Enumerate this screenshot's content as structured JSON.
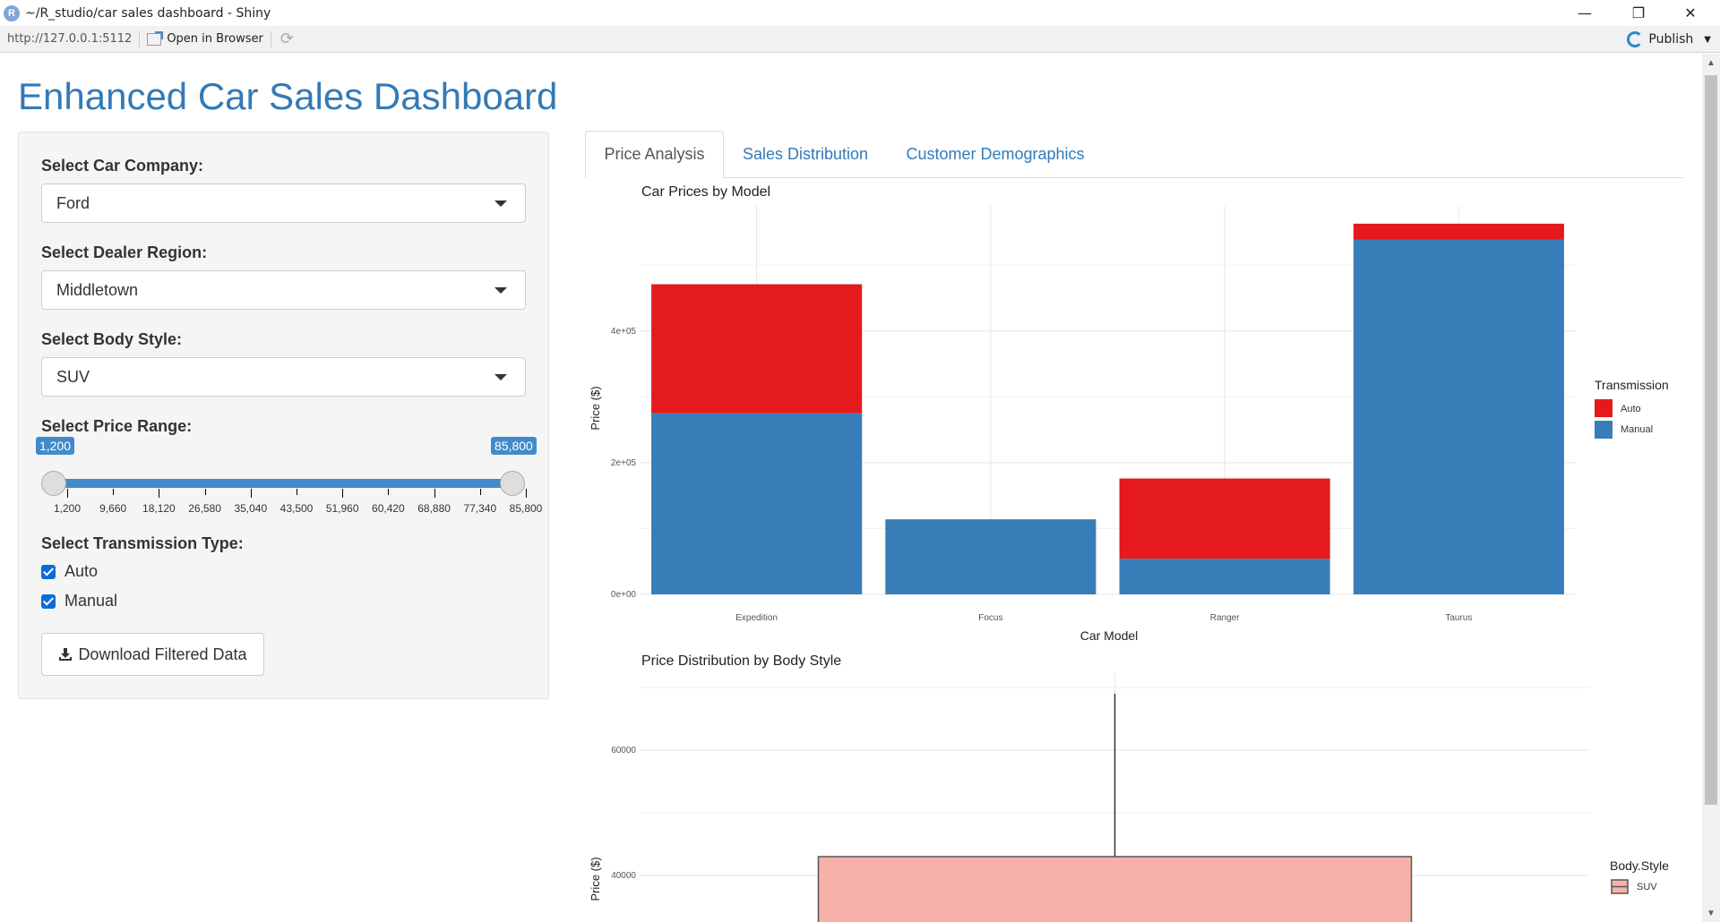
{
  "window": {
    "title": "~/R_studio/car sales dashboard - Shiny",
    "minimize": "—",
    "restore": "❐",
    "close": "✕"
  },
  "toolbar": {
    "url": "http://127.0.0.1:5112",
    "open_in_browser": "Open in Browser",
    "publish": "Publish"
  },
  "app": {
    "title": "Enhanced Car Sales Dashboard"
  },
  "sidebar": {
    "company_label": "Select Car Company:",
    "company_value": "Ford",
    "region_label": "Select Dealer Region:",
    "region_value": "Middletown",
    "body_label": "Select Body Style:",
    "body_value": "SUV",
    "price_label": "Select Price Range:",
    "price_min": "1,200",
    "price_max": "85,800",
    "price_ticks": [
      "1,200",
      "9,660",
      "18,120",
      "26,580",
      "35,040",
      "43,500",
      "51,960",
      "60,420",
      "68,880",
      "77,340",
      "85,800"
    ],
    "transmission_label": "Select Transmission Type:",
    "transmission_options": [
      {
        "label": "Auto",
        "checked": true
      },
      {
        "label": "Manual",
        "checked": true
      }
    ],
    "download_label": "Download Filtered Data"
  },
  "tabs": [
    {
      "label": "Price Analysis",
      "active": true
    },
    {
      "label": "Sales Distribution",
      "active": false
    },
    {
      "label": "Customer Demographics",
      "active": false
    }
  ],
  "colors": {
    "auto": "#e41a1c",
    "manual": "#377eb8",
    "suv": "#f8b1aa",
    "accent": "#337ab7"
  },
  "chart_data": [
    {
      "type": "bar",
      "stacked": true,
      "title": "Car Prices by Model",
      "xlabel": "Car Model",
      "ylabel": "Price ($)",
      "categories": [
        "Expedition",
        "Focus",
        "Ranger",
        "Taurus"
      ],
      "series": [
        {
          "name": "Auto",
          "values": [
            196000,
            0,
            122000,
            24000
          ]
        },
        {
          "name": "Manual",
          "values": [
            275000,
            114000,
            54000,
            539000
          ]
        }
      ],
      "ylim": [
        0,
        590000
      ],
      "yticks": [
        0,
        200000,
        400000
      ],
      "ytick_labels": [
        "0e+00",
        "2e+05",
        "4e+05"
      ],
      "legend_title": "Transmission",
      "legend_position": "right",
      "grid": true
    },
    {
      "type": "box",
      "title": "Price Distribution by Body Style",
      "ylabel": "Price ($)",
      "categories": [
        "SUV"
      ],
      "box": {
        "upper_whisker": 69000,
        "q3": 43000
      },
      "yticks": [
        40000,
        60000
      ],
      "ytick_labels": [
        "40000",
        "60000"
      ],
      "legend_title": "Body.Style",
      "legend_position": "right",
      "grid": true
    }
  ]
}
